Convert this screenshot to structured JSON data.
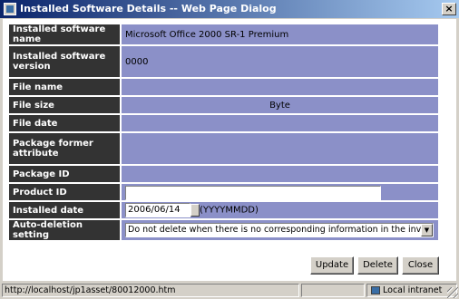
{
  "window": {
    "title": "Installed Software Details -- Web Page Dialog",
    "close_label": "×"
  },
  "details": {
    "rows": [
      {
        "label": "Installed software name",
        "value": "Microsoft Office 2000 SR-1 Premium"
      },
      {
        "label": "Installed software version",
        "value": "0000"
      },
      {
        "label": "File name",
        "value": ""
      },
      {
        "label": "File size",
        "value": "Byte"
      },
      {
        "label": "File date",
        "value": ""
      },
      {
        "label": "Package former attribute",
        "value": ""
      },
      {
        "label": "Package ID",
        "value": ""
      }
    ],
    "product_id": {
      "label": "Product ID",
      "value": ""
    },
    "installed_date": {
      "label": "Installed date",
      "value": "2006/06/14",
      "format": "(YYYYMMDD)"
    },
    "auto_deletion": {
      "label": "Auto-deletion setting",
      "selected": "Do not delete when there is no corresponding information in the inventory"
    }
  },
  "buttons": {
    "update": "Update",
    "delete": "Delete",
    "close": "Close"
  },
  "status": {
    "url": "http://localhost/jp1asset/80012000.htm",
    "zone": "Local intranet"
  }
}
